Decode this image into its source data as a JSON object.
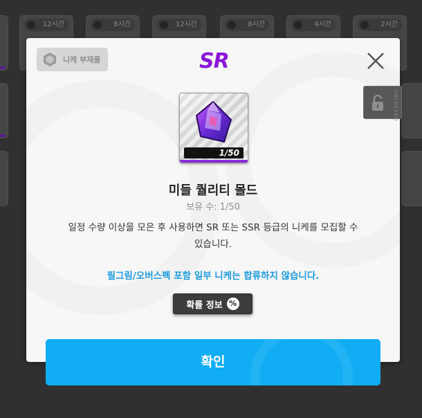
{
  "background": {
    "timer_labels": [
      "12시간",
      "8시간",
      "12시간",
      "8시간",
      "4시간",
      "2시간"
    ]
  },
  "modal": {
    "category_label": "니케 부재품",
    "rarity": "SR",
    "item": {
      "name": "미들 퀄리티 몰드",
      "count_display": "1/50",
      "owned_text": "보유 수: 1/50"
    },
    "description_line1": "일정 수량 이상을 모은 후 사용하면 SR 또는 SSR 등급의 니케를 모집할 수",
    "description_line2": "있습니다.",
    "notice": "필그림/오버스펙 포함 일부 니케는 합류하지 않습니다.",
    "probability_button": "확률 정보",
    "probability_icon": "%",
    "confirm_button": "확인"
  },
  "lock_tab": {
    "label": "UNLOCKED"
  },
  "colors": {
    "rarity_purple": "#8b16d8",
    "notice_blue": "#1c9bdc",
    "confirm_blue": "#10adf4"
  }
}
